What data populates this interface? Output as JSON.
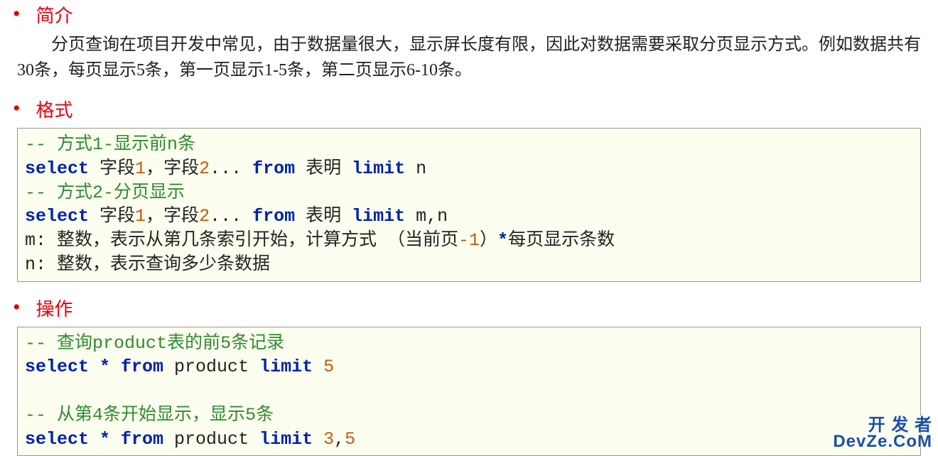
{
  "sections": {
    "intro": {
      "title": "简介",
      "paragraph": "分页查询在项目开发中常见，由于数据量很大，显示屏长度有限，因此对数据需要采取分页显示方式。例如数据共有30条，每页显示5条，第一页显示1-5条，第二页显示6-10条。"
    },
    "format": {
      "title": "格式",
      "code": {
        "l1_comment_prefix": "-- ",
        "l1_comment": "方式1-显示前n条",
        "l2_kw_select": "select",
        "l2_field": "字段",
        "l2_num1": "1",
        "l2_comma": "，字段",
        "l2_num2": "2",
        "l2_dots": "... ",
        "l2_kw_from": "from",
        "l2_table": " 表明 ",
        "l2_kw_limit": "limit",
        "l2_limit_arg": " n",
        "l3_comment_prefix": "-- ",
        "l3_comment": "方式2-分页显示",
        "l4_kw_select": "select",
        "l4_field": " 字段",
        "l4_num1": "1",
        "l4_comma": "，字段",
        "l4_num2": "2",
        "l4_dots": "... ",
        "l4_kw_from": "from",
        "l4_table": " 表明 ",
        "l4_kw_limit": "limit",
        "l4_limit_arg": " m,n",
        "l5_a": "m: 整数，表示从第几条索引开始，计算方式 （当前页",
        "l5_minus": "-1",
        "l5_b": "）",
        "l5_star": "*",
        "l5_c": "每页显示条数",
        "l6": "n: 整数，表示查询多少条数据"
      }
    },
    "ops": {
      "title": "操作",
      "code": {
        "l1_comment_prefix": "-- ",
        "l1_a": "查询",
        "l1_b": "product",
        "l1_c": "表的前",
        "l1_d": "5",
        "l1_e": "条记录",
        "l2_kw_select": "select",
        "l2_star": " * ",
        "l2_kw_from": "from",
        "l2_table": " product ",
        "l2_kw_limit": "limit",
        "l2_sp": " ",
        "l2_arg": "5",
        "l3_blank": " ",
        "l4_comment_prefix": "-- ",
        "l4_a": "从第",
        "l4_b": "4",
        "l4_c": "条开始显示，显示",
        "l4_d": "5",
        "l4_e": "条",
        "l5_kw_select": "select",
        "l5_star": " * ",
        "l5_kw_from": "from",
        "l5_table": " product ",
        "l5_kw_limit": "limit",
        "l5_sp": " ",
        "l5_arg1": "3",
        "l5_comma": ",",
        "l5_arg2": "5"
      }
    }
  },
  "watermark": {
    "line1": "开 发 者",
    "line2": "DevZe.CoM"
  }
}
